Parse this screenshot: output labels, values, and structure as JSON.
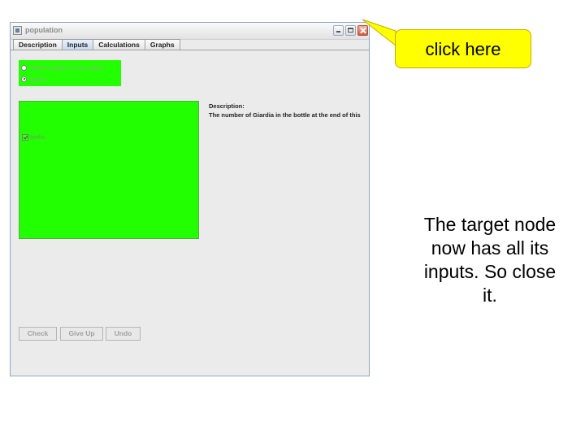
{
  "window": {
    "title": "population",
    "controls": [
      "minimize-icon",
      "maximize-icon",
      "close-icon"
    ]
  },
  "tabs": [
    {
      "label": "Description",
      "active": false
    },
    {
      "label": "Inputs",
      "active": true
    },
    {
      "label": "Calculations",
      "active": false
    },
    {
      "label": "Graphs",
      "active": false
    }
  ],
  "inputs_tab": {
    "radio_options": [
      {
        "label": "Value is given, so no inputs",
        "selected": false
      },
      {
        "label": "Inputs:",
        "selected": true
      }
    ],
    "input_nodes": [
      {
        "label": "births",
        "checked": true
      }
    ],
    "description_label": "Description:",
    "description_text": "The number of Giardia in the bottle at the end of this",
    "panel_color": "#22ff00"
  },
  "buttons": {
    "check": "Check",
    "give_up": "Give Up",
    "undo": "Undo"
  },
  "annotation": {
    "callout_text": "click here",
    "callout_color": "#ffff00",
    "instruction": "The target node now has all its inputs. So close it."
  }
}
